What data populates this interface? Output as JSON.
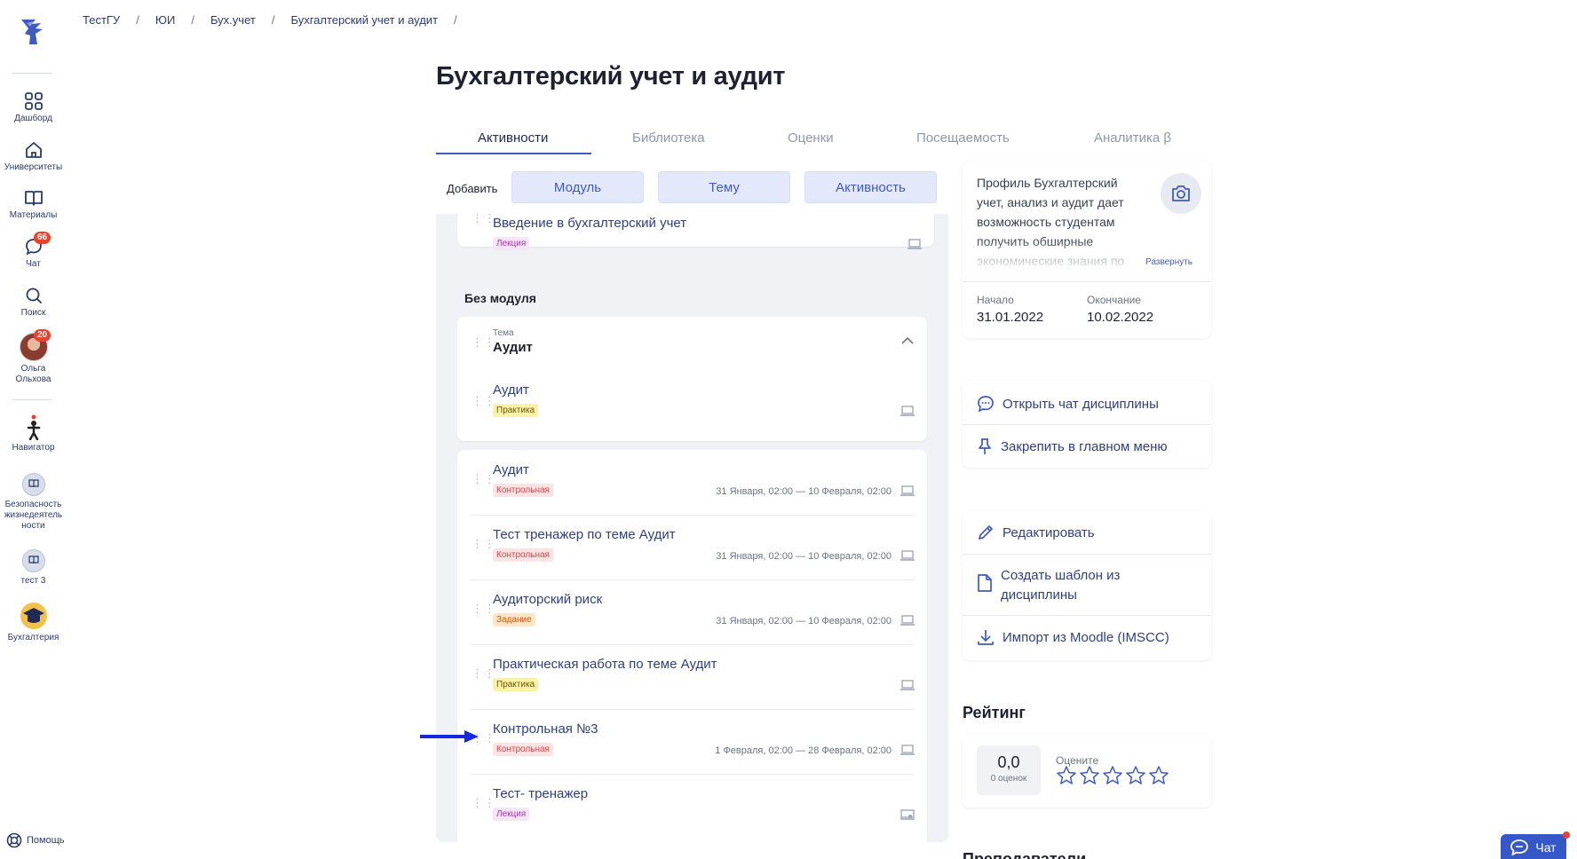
{
  "breadcrumb": [
    "ТестГУ",
    "ЮИ",
    "Бух.учет",
    "Бухгалтерский учет и аудит"
  ],
  "page_title": "Бухгалтерский учет и аудит",
  "tabs": [
    {
      "label": "Активности",
      "active": true
    },
    {
      "label": "Библиотека",
      "active": false
    },
    {
      "label": "Оценки",
      "active": false
    },
    {
      "label": "Посещаемость",
      "active": false
    },
    {
      "label": "Аналитика β",
      "active": false
    }
  ],
  "sidebar": {
    "items": [
      {
        "label": "Дашборд",
        "icon": "dashboard-icon"
      },
      {
        "label": "Университеты",
        "icon": "home-icon"
      },
      {
        "label": "Материалы",
        "icon": "book-icon"
      },
      {
        "label": "Чат",
        "icon": "chat-icon",
        "badge": "66"
      },
      {
        "label": "Поиск",
        "icon": "search-icon"
      },
      {
        "label": "Ольга Ольхова",
        "icon": "avatar",
        "badge": "20"
      },
      {
        "label": "Навигатор",
        "icon": "navigator-icon"
      },
      {
        "label": "Безопасность жизнедеятель ности",
        "icon": "course-icon"
      },
      {
        "label": "тест 3",
        "icon": "course-icon"
      },
      {
        "label": "Бухгалтерия",
        "icon": "graduation-cap-icon"
      }
    ],
    "help": "Помощь"
  },
  "add_bar": {
    "label": "Добавить",
    "buttons": [
      "Модуль",
      "Тему",
      "Активность"
    ]
  },
  "top_card": {
    "title": "Введение в бухгалтерский учет",
    "tag": "Лекция"
  },
  "section_label": "Без модуля",
  "topic": {
    "caption": "Тема",
    "title": "Аудит",
    "activity": {
      "title": "Аудит",
      "tag": "Практика"
    }
  },
  "activities": [
    {
      "title": "Аудит",
      "tag": "Контрольная",
      "dates": "31 Января, 02:00 — 10 Февраля, 02:00"
    },
    {
      "title": "Тест тренажер по теме Аудит",
      "tag": "Контрольная",
      "dates": "31 Января, 02:00 — 10 Февраля, 02:00"
    },
    {
      "title": "Аудиторский риск",
      "tag": "Задание",
      "dates": "31 Января, 02:00 — 10 Февраля, 02:00"
    },
    {
      "title": "Практическая работа по теме Аудит",
      "tag": "Практика",
      "dates": ""
    },
    {
      "title": "Контрольная №3",
      "tag": "Контрольная",
      "dates": "1 Февраля, 02:00 — 28 Февраля, 02:00"
    },
    {
      "title": "Тест- тренажер",
      "tag": "Лекция",
      "dates": ""
    }
  ],
  "profile": {
    "description": "Профиль Бухгалтерский учет, анализ и аудит дает возможность студентам получить обширные экономические знания по",
    "expand": "Развернуть",
    "start_label": "Начало",
    "start": "31.01.2022",
    "end_label": "Окончание",
    "end": "10.02.2022"
  },
  "actions1": [
    "Открыть чат дисциплины",
    "Закрепить в главном меню"
  ],
  "actions2": [
    "Редактировать",
    "Создать шаблон из дисциплины",
    "Импорт из Moodle (IMSCC)"
  ],
  "rating": {
    "title": "Рейтинг",
    "score": "0,0",
    "count": "0 оценок",
    "rate_label": "Оцените",
    "stars": 5
  },
  "teachers_title": "Преподаватели",
  "chat_button": "Чат",
  "colors": {
    "accent": "#3f5bbd",
    "badge": "#e8412c",
    "title_link": "#2f3f7a"
  }
}
